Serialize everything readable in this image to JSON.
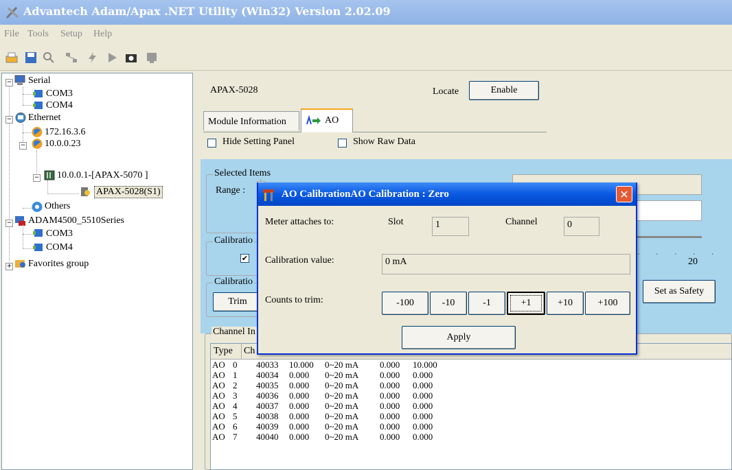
{
  "window": {
    "title": "Advantech Adam/Apax .NET Utility (Win32) Version 2.02.09"
  },
  "menu": [
    "File",
    "Tools",
    "Setup",
    "Help"
  ],
  "toolbar": [
    "print-icon",
    "save-icon",
    "search-icon",
    "network-icon",
    "lightning-icon",
    "play-icon",
    "camera-icon",
    "monitor-icon"
  ],
  "tree": {
    "serial": "Serial",
    "com3": "COM3",
    "com4": "COM4",
    "ethernet": "Ethernet",
    "ip1": "172.16.3.6",
    "ip2": "10.0.0.23",
    "device": "10.0.0.1-[APAX-5070 ]",
    "module": "APAX-5028(S1)",
    "others": "Others",
    "adam": "ADAM4500_5510Series",
    "adam_com3": "COM3",
    "adam_com4": "COM4",
    "favorites": "Favorites group"
  },
  "module": {
    "name": "APAX-5028",
    "locate_label": "Locate",
    "enable_label": "Enable",
    "tabs": [
      "Module Information",
      "AO"
    ],
    "hide_setting": "Hide Setting Panel",
    "show_raw": "Show Raw Data",
    "selected_items": "Selected Items",
    "range_label": "Range :",
    "calibration_group1": "Calibratio",
    "calibration_group2": "Calibratio",
    "trim_label": "Trim",
    "set_safety_label": "Set as Safety",
    "slider_max": "20",
    "channel_info": "Channel In",
    "checkbox_check": "✔"
  },
  "list": {
    "headers": [
      "Type",
      "Ch"
    ],
    "rows": [
      [
        "AO",
        "0",
        "40033",
        "10.000",
        "0~20 mA",
        "0.000",
        "10.000"
      ],
      [
        "AO",
        "1",
        "40034",
        "0.000",
        "0~20 mA",
        "0.000",
        "0.000"
      ],
      [
        "AO",
        "2",
        "40035",
        "0.000",
        "0~20 mA",
        "0.000",
        "0.000"
      ],
      [
        "AO",
        "3",
        "40036",
        "0.000",
        "0~20 mA",
        "0.000",
        "0.000"
      ],
      [
        "AO",
        "4",
        "40037",
        "0.000",
        "0~20 mA",
        "0.000",
        "0.000"
      ],
      [
        "AO",
        "5",
        "40038",
        "0.000",
        "0~20 mA",
        "0.000",
        "0.000"
      ],
      [
        "AO",
        "6",
        "40039",
        "0.000",
        "0~20 mA",
        "0.000",
        "0.000"
      ],
      [
        "AO",
        "7",
        "40040",
        "0.000",
        "0~20 mA",
        "0.000",
        "0.000"
      ]
    ]
  },
  "dialog": {
    "title": "AO CalibrationAO Calibration : Zero",
    "meter_label": "Meter attaches to:",
    "slot_label": "Slot",
    "slot_value": "1",
    "channel_label": "Channel",
    "channel_value": "0",
    "calibration_value_label": "Calibration value:",
    "calibration_value": "0 mA",
    "counts_label": "Counts to trim:",
    "trim_buttons": [
      "-100",
      "-10",
      "-1",
      "+1",
      "+10",
      "+100"
    ],
    "apply_label": "Apply",
    "close_glyph": "✕"
  }
}
